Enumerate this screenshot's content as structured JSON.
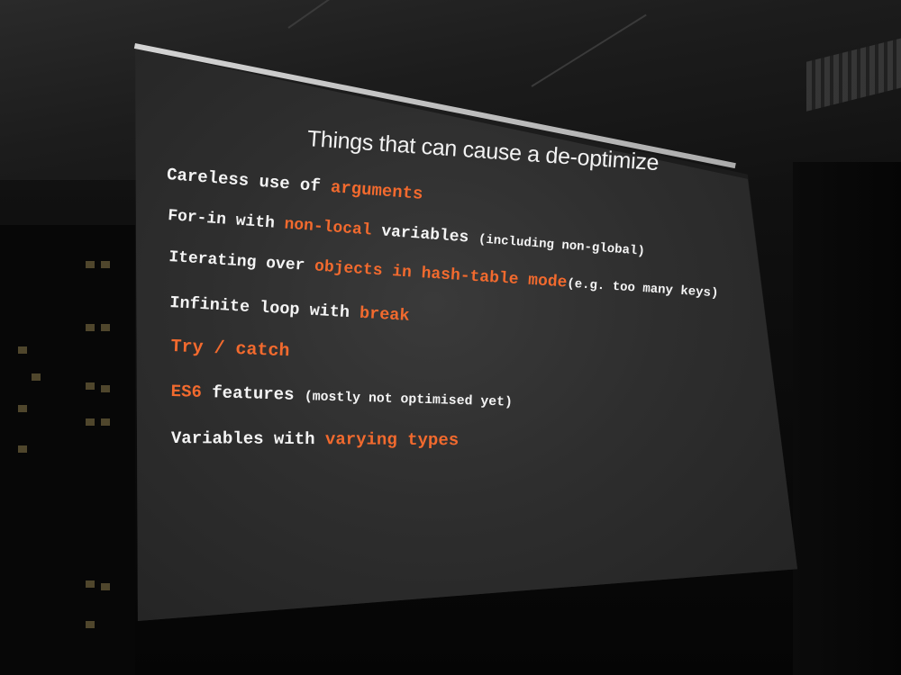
{
  "slide": {
    "title": "Things that can cause a de-optimize",
    "lines": [
      {
        "pre": "Careless use of ",
        "highlight": "arguments",
        "post": ""
      },
      {
        "pre": "For-in with ",
        "highlight": "non-local",
        "post": " variables ",
        "note": "(including non-global)"
      },
      {
        "pre": "Iterating over ",
        "highlight": "objects in hash-table mode",
        "post": "",
        "note": "(e.g. too many keys)"
      },
      {
        "pre": "Infinite loop with ",
        "highlight": "break",
        "post": ""
      },
      {
        "pre": "",
        "highlight": "Try / catch",
        "post": ""
      },
      {
        "pre": "",
        "highlight": "ES6",
        "post": " features ",
        "note": "(mostly not optimised yet)"
      },
      {
        "pre": "Variables with ",
        "highlight": "varying types",
        "post": ""
      }
    ]
  },
  "colors": {
    "slide_background": "#2e2e2e",
    "text": "#f4f4f4",
    "highlight": "#f26a2e"
  }
}
